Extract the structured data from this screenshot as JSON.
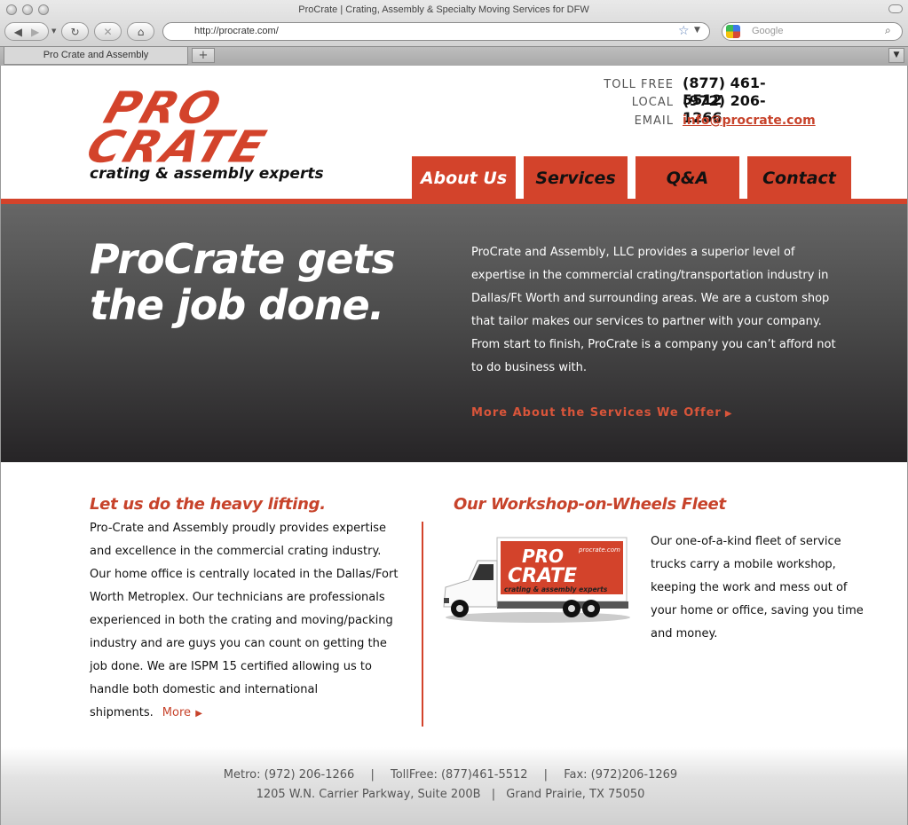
{
  "browser": {
    "window_title": "ProCrate | Crating, Assembly & Specialty Moving Services for DFW",
    "url": "http://procrate.com/",
    "search_placeholder": "Google",
    "tab_title": "Pro Crate and Assembly",
    "new_tab": "+"
  },
  "logo": {
    "line1": "PRO",
    "line2": "CRATE",
    "tagline": "crating & assembly experts"
  },
  "contact": {
    "toll_free_label": "TOLL FREE",
    "toll_free": "(877) 461-5512",
    "local_label": "LOCAL",
    "local": "(972) 206-1266",
    "email_label": "EMAIL",
    "email": "info@procrate.com"
  },
  "nav": {
    "items": [
      {
        "label": "About Us"
      },
      {
        "label": "Services"
      },
      {
        "label": "Q&A"
      },
      {
        "label": "Contact"
      }
    ],
    "active": "About Us"
  },
  "hero": {
    "title_line1": "ProCrate gets",
    "title_line2": "the job done.",
    "text": "ProCrate and Assembly, LLC provides a superior level of expertise in the commercial crating/transportation industry in Dallas/Ft Worth and surrounding areas. We are a custom shop that tailor makes our services to partner with your company. From start to finish, ProCrate is a company you can’t afford not to do business with.",
    "link": "More About the Services We Offer"
  },
  "left": {
    "heading": "Let us do the heavy lifting.",
    "body": "Pro-Crate and Assembly proudly provides expertise and excellence in the commercial crating industry. Our home office is centrally located in the Dallas/Fort Worth Metroplex. Our technicians are professionals experienced in both the crating and moving/packing industry and are guys you can count on getting the job done. We are ISPM 15 certified allowing us to handle both domestic and international shipments.",
    "more": "More"
  },
  "right": {
    "heading": "Our Workshop-on-Wheels Fleet",
    "body": "Our one-of-a-kind fleet of service trucks carry a mobile workshop, keeping the work and mess out of your home or office, saving you time and money.",
    "truck_logo_line1": "PRO",
    "truck_logo_line2": "CRATE",
    "truck_tagline": "crating & assembly experts",
    "truck_url": "procrate.com"
  },
  "footer": {
    "metro": "Metro: (972) 206-1266",
    "tollfree": "TollFree: (877)461-5512",
    "fax": "Fax: (972)206-1269",
    "address": "1205 W.N. Carrier Parkway, Suite 200B",
    "city": "Grand Prairie, TX 75050",
    "separator": "|"
  },
  "colors": {
    "brand_red": "#d3432b",
    "hero_dark": "#262426"
  }
}
